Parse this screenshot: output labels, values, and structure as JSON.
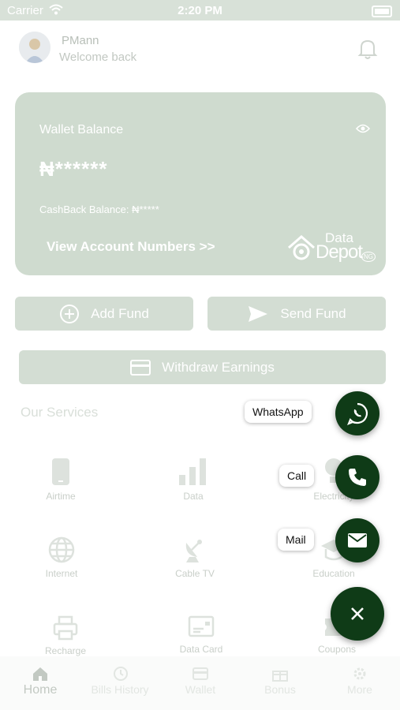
{
  "status_bar": {
    "carrier": "Carrier",
    "time": "2:20 PM"
  },
  "header": {
    "username": "PMann",
    "subtitle": "Welcome back"
  },
  "wallet": {
    "label": "Wallet Balance",
    "balance": "₦******",
    "cashback": "CashBack Balance:  ₦*****",
    "view_accounts": "View Account Numbers >>",
    "logo_text_1": "Data",
    "logo_text_2": "Depot",
    "logo_badge": "NG"
  },
  "actions": {
    "add_fund": "Add Fund",
    "send_fund": "Send Fund",
    "withdraw": "Withdraw Earnings"
  },
  "services_title": "Our Services",
  "services": [
    {
      "label": "Airtime",
      "icon": "phone-icon"
    },
    {
      "label": "Data",
      "icon": "signal-bars-icon"
    },
    {
      "label": "Electricity",
      "icon": "bulb-icon"
    },
    {
      "label": "Internet",
      "icon": "globe-icon"
    },
    {
      "label": "Cable TV",
      "icon": "satellite-dish-icon"
    },
    {
      "label": "Education",
      "icon": "graduation-cap-icon"
    },
    {
      "label": "Recharge",
      "icon": "printer-icon"
    },
    {
      "label": "Data Card",
      "icon": "card-icon"
    },
    {
      "label": "Coupons",
      "icon": "ticket-icon"
    }
  ],
  "fab_menu": {
    "whatsapp": "WhatsApp",
    "call": "Call",
    "mail": "Mail"
  },
  "bottom_nav": [
    {
      "label": "Home",
      "icon": "home-icon"
    },
    {
      "label": "Bills History",
      "icon": "history-icon"
    },
    {
      "label": "Wallet",
      "icon": "wallet-icon"
    },
    {
      "label": "Bonus",
      "icon": "gift-icon"
    },
    {
      "label": "More",
      "icon": "gear-icon"
    }
  ],
  "colors": {
    "fab": "#0f3b17",
    "card": "#cfdbcf",
    "button": "#d3ddd3"
  }
}
